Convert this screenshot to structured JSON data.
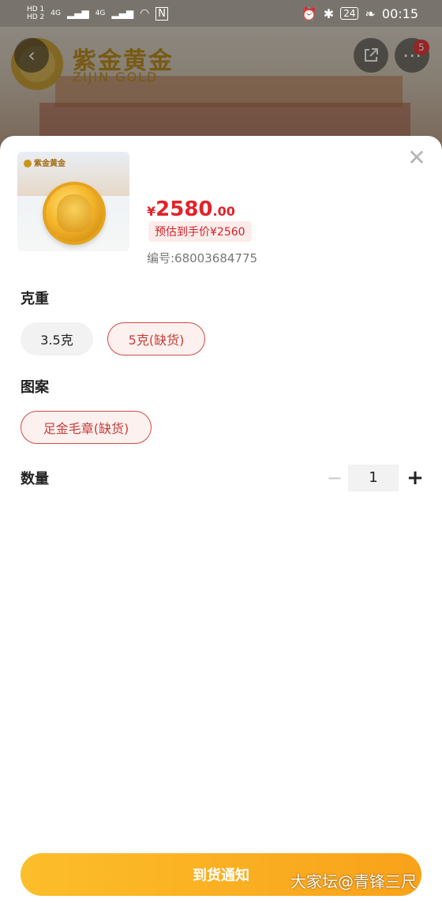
{
  "status_bar": {
    "sim1": "HD 1",
    "sim2": "HD 2",
    "net1": "4G",
    "net2": "4G",
    "battery": "24",
    "time": "00:15"
  },
  "background": {
    "brand_cn": "紫金黄金",
    "brand_en": "ZIJIN GOLD",
    "more_badge": "5"
  },
  "product": {
    "thumb_brand": "紫金黄金",
    "price_symbol": "¥",
    "price_integer": "2580",
    "price_decimal": ".00",
    "estimated_label": "预估到手价¥2560",
    "sku_number": "编号:68003684775"
  },
  "weight_section": {
    "label": "克重",
    "options": [
      {
        "label": "3.5克",
        "state": "normal"
      },
      {
        "label": "5克(缺货)",
        "state": "out-of-stock"
      }
    ]
  },
  "pattern_section": {
    "label": "图案",
    "options": [
      {
        "label": "足金毛章(缺货)",
        "state": "out-of-stock"
      }
    ]
  },
  "quantity_section": {
    "label": "数量",
    "minus": "−",
    "value": "1",
    "plus": "+"
  },
  "actions": {
    "notify_label": "到货通知",
    "close_icon": "✕"
  },
  "watermark": "大家坛@青锋三尺",
  "colors": {
    "price_red": "#e0232a",
    "oos_border": "#d24a45",
    "button_orange": "#f9a21a"
  }
}
